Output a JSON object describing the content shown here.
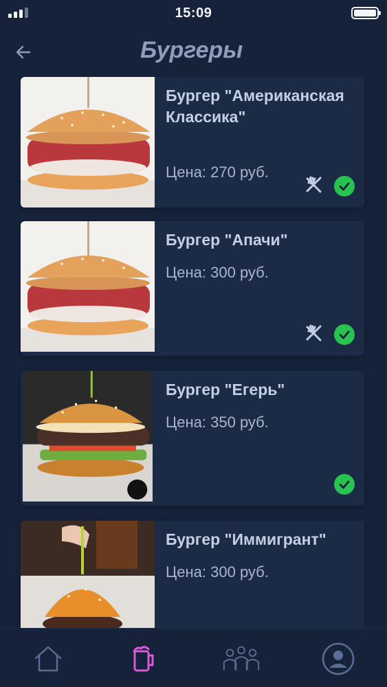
{
  "status": {
    "time": "15:09"
  },
  "header": {
    "title": "Бургеры"
  },
  "items": [
    {
      "title": "Бургер \"Американская Классика\"",
      "price": "Цена: 270 руб.",
      "photo": "burger-photo-1",
      "has_cutlery": true,
      "checked": true
    },
    {
      "title": "Бургер \"Апачи\"",
      "price": "Цена: 300 руб.",
      "photo": "burger-photo-2",
      "has_cutlery": true,
      "checked": true
    },
    {
      "title": "Бургер \"Егерь\"",
      "price": "Цена: 350 руб.",
      "photo": "burger-photo-3",
      "has_cutlery": false,
      "checked": true
    },
    {
      "title": "Бургер \"Иммигрант\"",
      "price": "Цена: 300 руб.",
      "photo": "burger-photo-4",
      "has_cutlery": false,
      "checked": true
    }
  ],
  "tabs": [
    {
      "icon": "home-icon",
      "active": false
    },
    {
      "icon": "beer-mug-icon",
      "active": true
    },
    {
      "icon": "people-icon",
      "active": false
    },
    {
      "icon": "profile-icon",
      "active": false
    }
  ],
  "colors": {
    "background": "#15223a",
    "card": "#1b2a45",
    "accent_active": "#d85ad8",
    "check": "#27c24f",
    "muted_icon": "#5a6d94"
  }
}
